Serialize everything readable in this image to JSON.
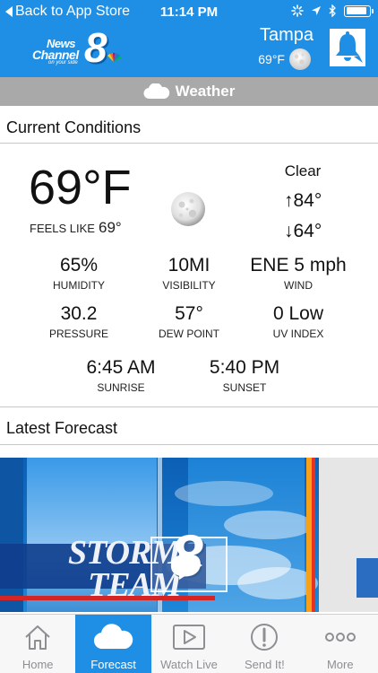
{
  "status_bar": {
    "back_label": "Back to App Store",
    "time": "11:14 PM"
  },
  "header": {
    "logo": {
      "line1": "News",
      "line2": "Channel",
      "numeral": "8",
      "tagline": "on your side"
    },
    "city": "Tampa",
    "temperature": "69°F",
    "icons": [
      "moon-icon",
      "alert-bell-icon"
    ]
  },
  "section_bar": {
    "label": "Weather",
    "icon": "cloud-icon"
  },
  "current_conditions": {
    "title": "Current Conditions",
    "temperature": "69°F",
    "feels_like_label": "FEELS LIKE",
    "feels_like_value": "69°",
    "condition": "Clear",
    "high": "↑84°",
    "low": "↓64°",
    "stats": [
      {
        "value": "65%",
        "label": "HUMIDITY"
      },
      {
        "value": "10MI",
        "label": "VISIBILITY"
      },
      {
        "value": "ENE 5 mph",
        "label": "WIND"
      },
      {
        "value": "30.2",
        "label": "PRESSURE"
      },
      {
        "value": "57°",
        "label": "DEW POINT"
      },
      {
        "value": "0 Low",
        "label": "UV INDEX"
      },
      {
        "value": "6:45 AM",
        "label": "SUNRISE"
      },
      {
        "value": "5:40 PM",
        "label": "SUNSET"
      }
    ]
  },
  "latest_forecast": {
    "title": "Latest Forecast",
    "video_brand_line1": "STORM",
    "video_brand_line2": "TEAM",
    "video_numeral": "8"
  },
  "tabs": [
    {
      "label": "Home",
      "icon": "home-icon",
      "active": false
    },
    {
      "label": "Forecast",
      "icon": "cloud-icon",
      "active": true
    },
    {
      "label": "Watch Live",
      "icon": "play-icon",
      "active": false
    },
    {
      "label": "Send It!",
      "icon": "exclamation-icon",
      "active": false
    },
    {
      "label": "More",
      "icon": "more-dots-icon",
      "active": false
    }
  ],
  "colors": {
    "header_blue": "#1f8fe5",
    "section_bar_gray": "#a9a9a9",
    "active_tab": "#1f8fe5",
    "inactive_tab_text": "#8e8e93"
  }
}
